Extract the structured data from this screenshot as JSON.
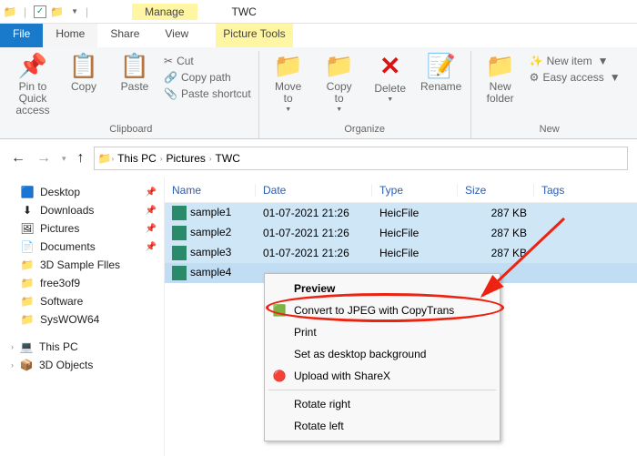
{
  "window": {
    "manage": "Manage",
    "picturetools": "Picture Tools",
    "title": "TWC"
  },
  "tabs": {
    "file": "File",
    "home": "Home",
    "share": "Share",
    "view": "View"
  },
  "ribbon": {
    "pin": "Pin to Quick\naccess",
    "copy": "Copy",
    "paste": "Paste",
    "cut": "Cut",
    "copypath": "Copy path",
    "pasteshortcut": "Paste shortcut",
    "clipboard": "Clipboard",
    "moveto": "Move\nto",
    "copyto": "Copy\nto",
    "delete": "Delete",
    "rename": "Rename",
    "organize": "Organize",
    "newfolder": "New\nfolder",
    "newitem": "New item",
    "easyaccess": "Easy access",
    "new": "New"
  },
  "breadcrumb": [
    "This PC",
    "Pictures",
    "TWC"
  ],
  "nav": [
    {
      "label": "Desktop",
      "icon": "🟦",
      "pinned": true
    },
    {
      "label": "Downloads",
      "icon": "⬇",
      "pinned": true
    },
    {
      "label": "Pictures",
      "icon": "🖼",
      "pinned": true
    },
    {
      "label": "Documents",
      "icon": "📄",
      "pinned": true
    },
    {
      "label": "3D Sample Flles",
      "icon": "📁",
      "pinned": false
    },
    {
      "label": "free3of9",
      "icon": "📁",
      "pinned": false
    },
    {
      "label": "Software",
      "icon": "📁",
      "pinned": false
    },
    {
      "label": "SysWOW64",
      "icon": "📁",
      "pinned": false
    }
  ],
  "nav2": [
    {
      "label": "This PC",
      "icon": "💻"
    },
    {
      "label": "3D Objects",
      "icon": "📦"
    }
  ],
  "cols": {
    "name": "Name",
    "date": "Date",
    "type": "Type",
    "size": "Size",
    "tags": "Tags"
  },
  "files": [
    {
      "name": "sample1",
      "date": "01-07-2021 21:26",
      "type": "HeicFile",
      "size": "287 KB"
    },
    {
      "name": "sample2",
      "date": "01-07-2021 21:26",
      "type": "HeicFile",
      "size": "287 KB"
    },
    {
      "name": "sample3",
      "date": "01-07-2021 21:26",
      "type": "HeicFile",
      "size": "287 KB"
    },
    {
      "name": "sample4",
      "date": "",
      "type": "",
      "size": ""
    }
  ],
  "ctx": {
    "preview": "Preview",
    "convert": "Convert to JPEG with CopyTrans",
    "print": "Print",
    "setbg": "Set as desktop background",
    "sharex": "Upload with ShareX",
    "rotright": "Rotate right",
    "rotleft": "Rotate left"
  }
}
